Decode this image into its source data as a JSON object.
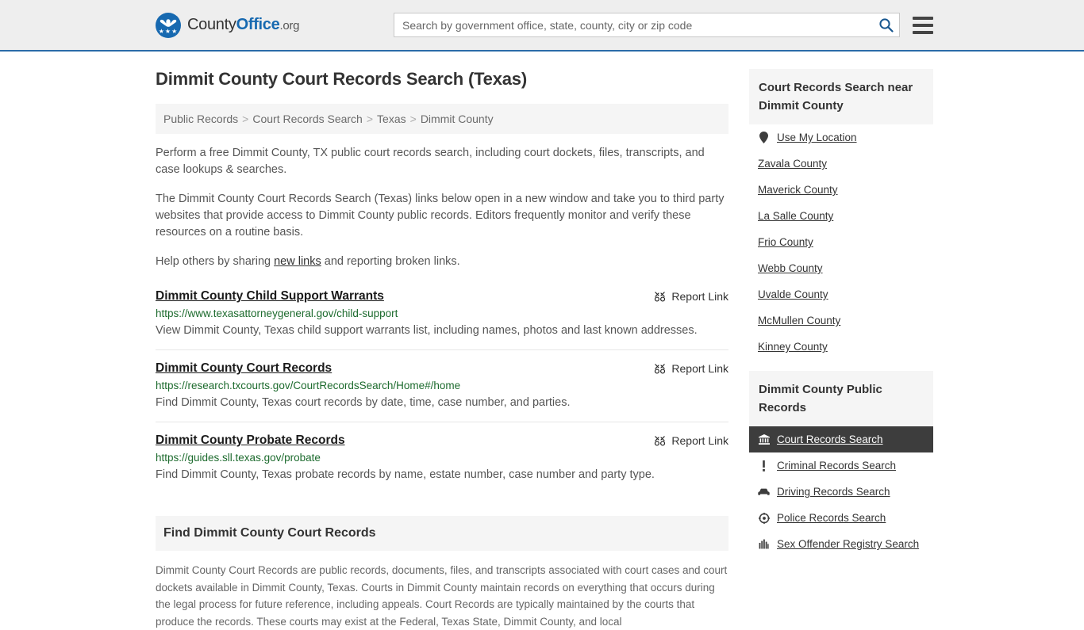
{
  "header": {
    "logo": {
      "word1": "County",
      "word2": "Office",
      "suffix": ".org",
      "icon": "eagle-seal-icon"
    },
    "search": {
      "placeholder": "Search by government office, state, county, city or zip code",
      "value": "",
      "icon": "search-icon"
    },
    "menu_icon": "hamburger-menu-icon",
    "accent_color": "#2a6ca8",
    "background": "#eeeeee"
  },
  "page": {
    "title": "Dimmit County Court Records Search (Texas)",
    "breadcrumb": [
      "Public Records",
      "Court Records Search",
      "Texas",
      "Dimmit County"
    ],
    "breadcrumb_separator": ">"
  },
  "intro": {
    "p1": "Perform a free Dimmit County, TX public court records search, including court dockets, files, transcripts, and case lookups & searches.",
    "p2": "The Dimmit County Court Records Search (Texas) links below open in a new window and take you to third party websites that provide access to Dimmit County public records. Editors frequently monitor and verify these resources on a routine basis.",
    "p3_before": "Help others by sharing ",
    "p3_link": "new links",
    "p3_after": " and reporting broken links."
  },
  "report_link_label": "Report Link",
  "report_link_icon": "broken-link-icon",
  "results": [
    {
      "title": "Dimmit County Child Support Warrants",
      "url": "https://www.texasattorneygeneral.gov/child-support",
      "description": "View Dimmit County, Texas child support warrants list, including names, photos and last known addresses."
    },
    {
      "title": "Dimmit County Court Records",
      "url": "https://research.txcourts.gov/CourtRecordsSearch/Home#/home",
      "description": "Find Dimmit County, Texas court records by date, time, case number, and parties."
    },
    {
      "title": "Dimmit County Probate Records",
      "url": "https://guides.sll.texas.gov/probate",
      "description": "Find Dimmit County, Texas probate records by name, estate number, case number and party type."
    }
  ],
  "section": {
    "heading": "Find Dimmit County Court Records",
    "body": "Dimmit County Court Records are public records, documents, files, and transcripts associated with court cases and court dockets available in Dimmit County, Texas. Courts in Dimmit County maintain records on everything that occurs during the legal process for future reference, including appeals. Court Records are typically maintained by the courts that produce the records. These courts may exist at the Federal, Texas State, Dimmit County, and local"
  },
  "sidebar": {
    "nearby": {
      "heading": "Court Records Search near Dimmit County",
      "items": [
        {
          "label": "Use My Location",
          "icon": "map-pin-icon"
        },
        {
          "label": "Zavala County",
          "icon": ""
        },
        {
          "label": "Maverick County",
          "icon": ""
        },
        {
          "label": "La Salle County",
          "icon": ""
        },
        {
          "label": "Frio County",
          "icon": ""
        },
        {
          "label": "Webb County",
          "icon": ""
        },
        {
          "label": "Uvalde County",
          "icon": ""
        },
        {
          "label": "McMullen County",
          "icon": ""
        },
        {
          "label": "Kinney County",
          "icon": ""
        }
      ]
    },
    "public_records": {
      "heading": "Dimmit County Public Records",
      "active_index": 0,
      "items": [
        {
          "label": "Court Records Search",
          "icon": "courthouse-icon"
        },
        {
          "label": "Criminal Records Search",
          "icon": "exclamation-icon"
        },
        {
          "label": "Driving Records Search",
          "icon": "car-icon"
        },
        {
          "label": "Police Records Search",
          "icon": "police-badge-icon"
        },
        {
          "label": "Sex Offender Registry Search",
          "icon": "fingerprint-icon"
        }
      ]
    },
    "highlight_color": "#3d3d3d",
    "panel_head_bg": "#f5f5f5"
  }
}
